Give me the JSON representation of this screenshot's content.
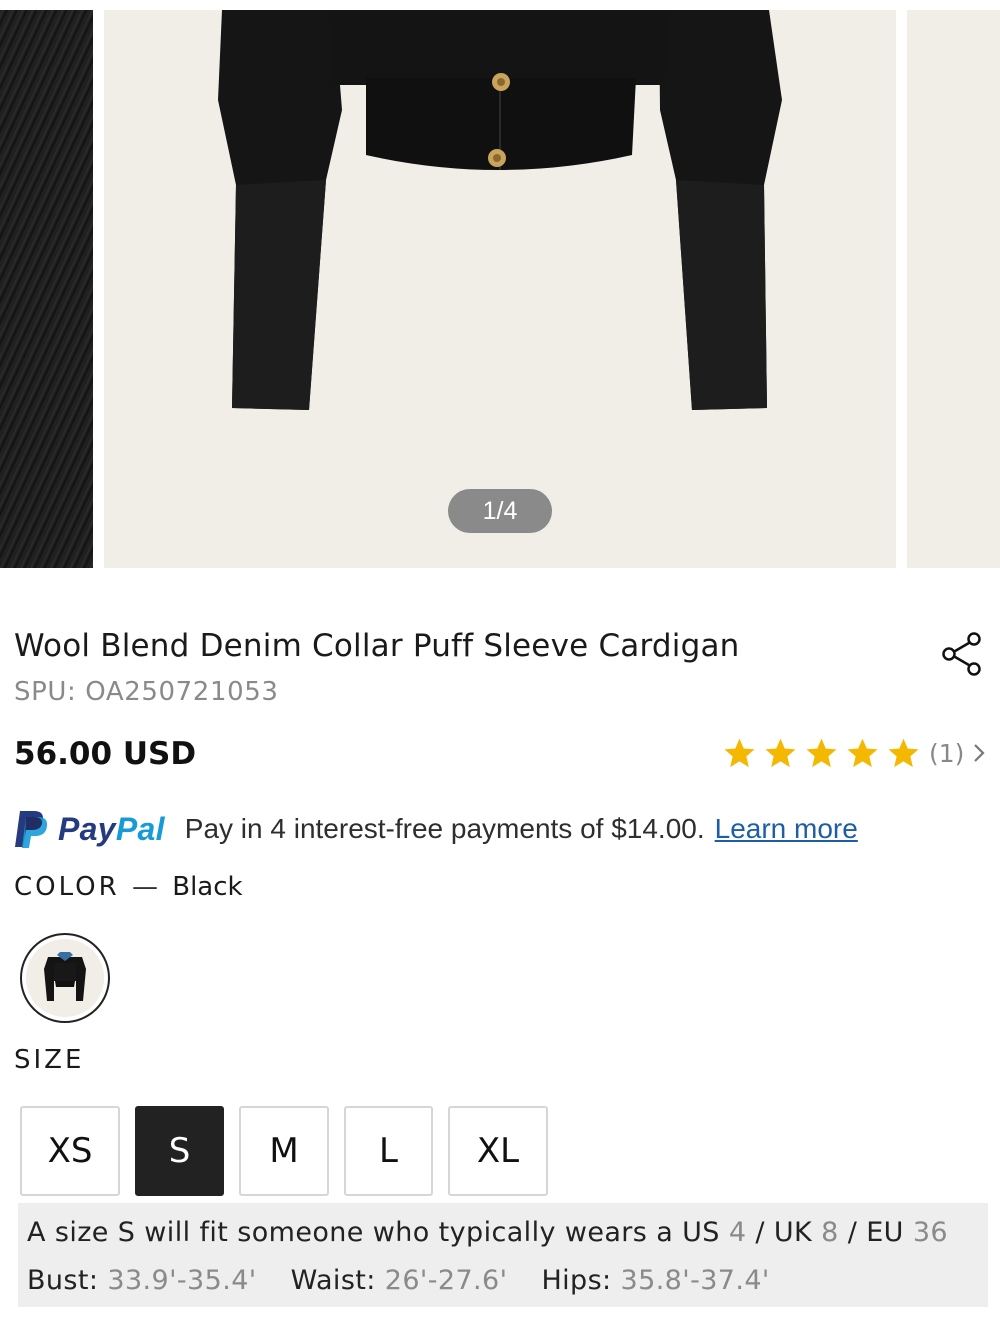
{
  "gallery": {
    "pager": "1/4"
  },
  "product": {
    "title": "Wool Blend Denim Collar Puff Sleeve Cardigan",
    "spu": "SPU: OA250721053",
    "price": "56.00 USD",
    "rating": {
      "stars": 5,
      "count_text": "(1)",
      "star_color": "#f5b800"
    }
  },
  "paypal": {
    "brand_part1": "Pay",
    "brand_part2": "Pal",
    "message": "Pay in 4 interest-free payments of $14.00.",
    "link": "Learn more",
    "colors": {
      "dark": "#253b80",
      "light": "#179bd7"
    }
  },
  "color": {
    "label": "COLOR",
    "separator": "—",
    "value": "Black"
  },
  "size": {
    "label": "SIZE",
    "options": [
      "XS",
      "S",
      "M",
      "L",
      "XL"
    ],
    "selected": "S",
    "fit": {
      "p1": "A size S will fit someone who typically wears a US ",
      "us": "4",
      "p2": " / UK ",
      "uk": "8",
      "p3": " / EU ",
      "eu": "36",
      "bust_label": "Bust: ",
      "bust": "33.9'-35.4'",
      "waist_label": "Waist: ",
      "waist": "26'-27.6'",
      "hips_label": "Hips: ",
      "hips": "35.8'-37.4'"
    }
  },
  "icons": [
    "share-icon",
    "star-icon",
    "chevron-right-icon",
    "paypal-logo-icon"
  ]
}
